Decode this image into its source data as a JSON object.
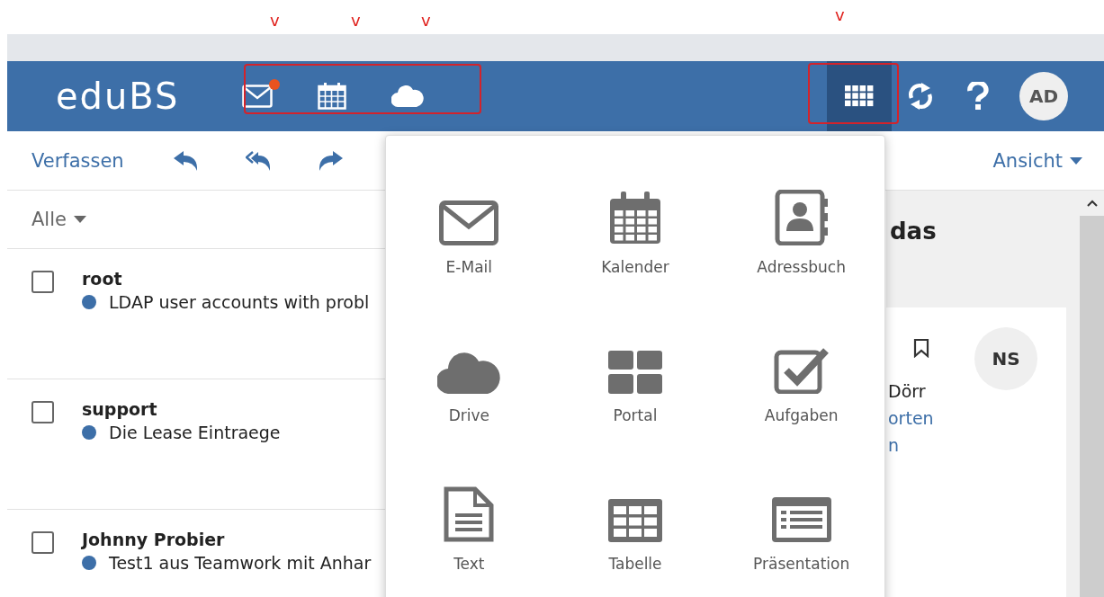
{
  "annotations": {
    "marks": [
      {
        "text": "v"
      },
      {
        "text": "v"
      },
      {
        "text": "v"
      },
      {
        "text": "v"
      }
    ],
    "highlights": [
      {
        "kind": "box"
      },
      {
        "kind": "box"
      }
    ]
  },
  "header": {
    "logo": "eduBS",
    "quick_icons": [
      {
        "kind": "mail",
        "badge": true
      },
      {
        "kind": "calendar",
        "badge": false
      },
      {
        "kind": "cloud",
        "badge": false
      }
    ],
    "app_launcher": {
      "selected": true
    },
    "avatar": "AD"
  },
  "toolbar": {
    "compose": "Verfassen",
    "view": "Ansicht"
  },
  "filter": "Alle",
  "messages": [
    {
      "sender": "root",
      "subject": "LDAP user accounts with probl",
      "checked": false,
      "unread": true
    },
    {
      "sender": "support",
      "subject": "Die Lease Eintraege",
      "checked": false,
      "unread": true
    },
    {
      "sender": "Johnny Probier",
      "subject": "Test1 aus Teamwork mit Anhar",
      "checked": false,
      "unread": true
    }
  ],
  "reading_pane": {
    "title": "das",
    "avatar": "NS",
    "from": "Dörr",
    "links": [
      "orten",
      "n"
    ]
  },
  "app_menu": [
    {
      "kind": "mail",
      "label": "E-Mail"
    },
    {
      "kind": "calendar",
      "label": "Kalender"
    },
    {
      "kind": "contacts",
      "label": "Adressbuch"
    },
    {
      "kind": "cloud",
      "label": "Drive"
    },
    {
      "kind": "portal",
      "label": "Portal"
    },
    {
      "kind": "tasks",
      "label": "Aufgaben"
    },
    {
      "kind": "text",
      "label": "Text"
    },
    {
      "kind": "table",
      "label": "Tabelle"
    },
    {
      "kind": "slides",
      "label": "Präsentation"
    }
  ]
}
